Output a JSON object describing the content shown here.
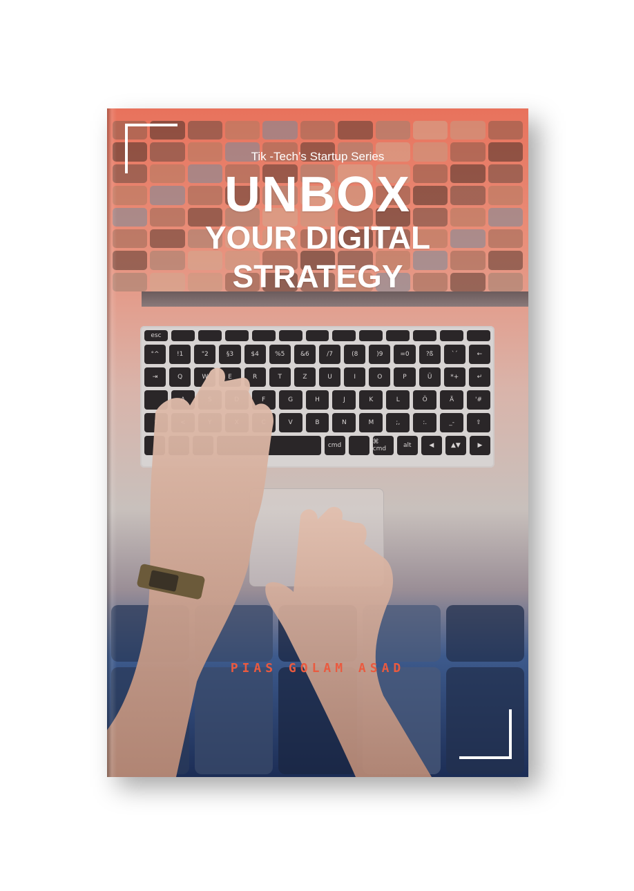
{
  "cover": {
    "series": "Tik -Tech’s Startup Series",
    "title_line1": "UNBOX",
    "title_line2": "YOUR DIGITAL",
    "title_line3": "STRATEGY",
    "author": "PIAS GOLAM ASAD"
  },
  "keyboard": {
    "rows": [
      [
        "esc",
        "",
        "",
        "",
        "",
        "",
        "",
        "",
        "",
        "",
        "",
        "",
        ""
      ],
      [
        "°^",
        "!1",
        "\"2",
        "§3",
        "$4",
        "%5",
        "&6",
        "/7",
        "(8",
        ")9",
        "=0",
        "?ß",
        "`´",
        "←"
      ],
      [
        "⇥",
        "Q",
        "W",
        "E",
        "R",
        "T",
        "Z",
        "U",
        "I",
        "O",
        "P",
        "Ü",
        "*+",
        "↵"
      ],
      [
        "",
        "A",
        "S",
        "D",
        "F",
        "G",
        "H",
        "J",
        "K",
        "L",
        "Ö",
        "Ä",
        "'#"
      ],
      [
        "⇧",
        "<",
        "Y",
        "X",
        "C",
        "V",
        "B",
        "N",
        "M",
        ";,",
        ":.",
        "_-",
        "⇧"
      ],
      [
        "",
        "",
        "",
        "",
        "cmd",
        "",
        "⌘ cmd",
        "alt",
        "◀",
        "▲▼",
        "▶"
      ]
    ]
  },
  "colors": {
    "top_tint": "#e8725c",
    "bottom_tint": "#1c2d55",
    "author_color": "#ea5a3f",
    "title_color": "#ffffff"
  }
}
